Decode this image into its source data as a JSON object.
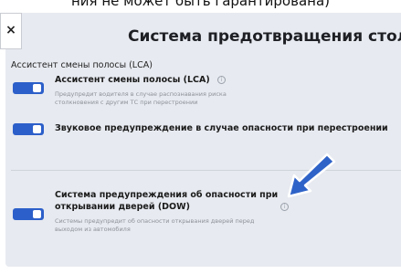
{
  "caption": "ния не может быть гарантирована)",
  "header": {
    "close_label": "×",
    "title": "Система предотвращения столкно"
  },
  "section": {
    "title": "Ассистент смены полосы (LCA)"
  },
  "items": [
    {
      "title": "Ассистент смены полосы (LCA)",
      "info": "i",
      "desc_line1": "Предупредит водителя в случае распознавания риска",
      "desc_line2": "столкновения с другим ТС при перестроении",
      "toggle_on": true
    },
    {
      "title": "Звуковое предупреждение в случае опасности при перестроении",
      "toggle_on": true
    },
    {
      "title_line1": "Система предупреждения об опасности при",
      "title_line2": "открывании дверей (DOW)",
      "info": "i",
      "desc_line1": "Системы предупредит об опасности открывания дверей перед",
      "desc_line2": "выходом из автомобиля",
      "toggle_on": true
    }
  ],
  "colors": {
    "toggle_on": "#2c5fc9",
    "panel_bg": "#e7eaf0",
    "arrow": "#2f63c8"
  },
  "icons": {
    "close": "close-icon",
    "info": "info-icon",
    "arrow": "pointer-arrow-icon"
  }
}
